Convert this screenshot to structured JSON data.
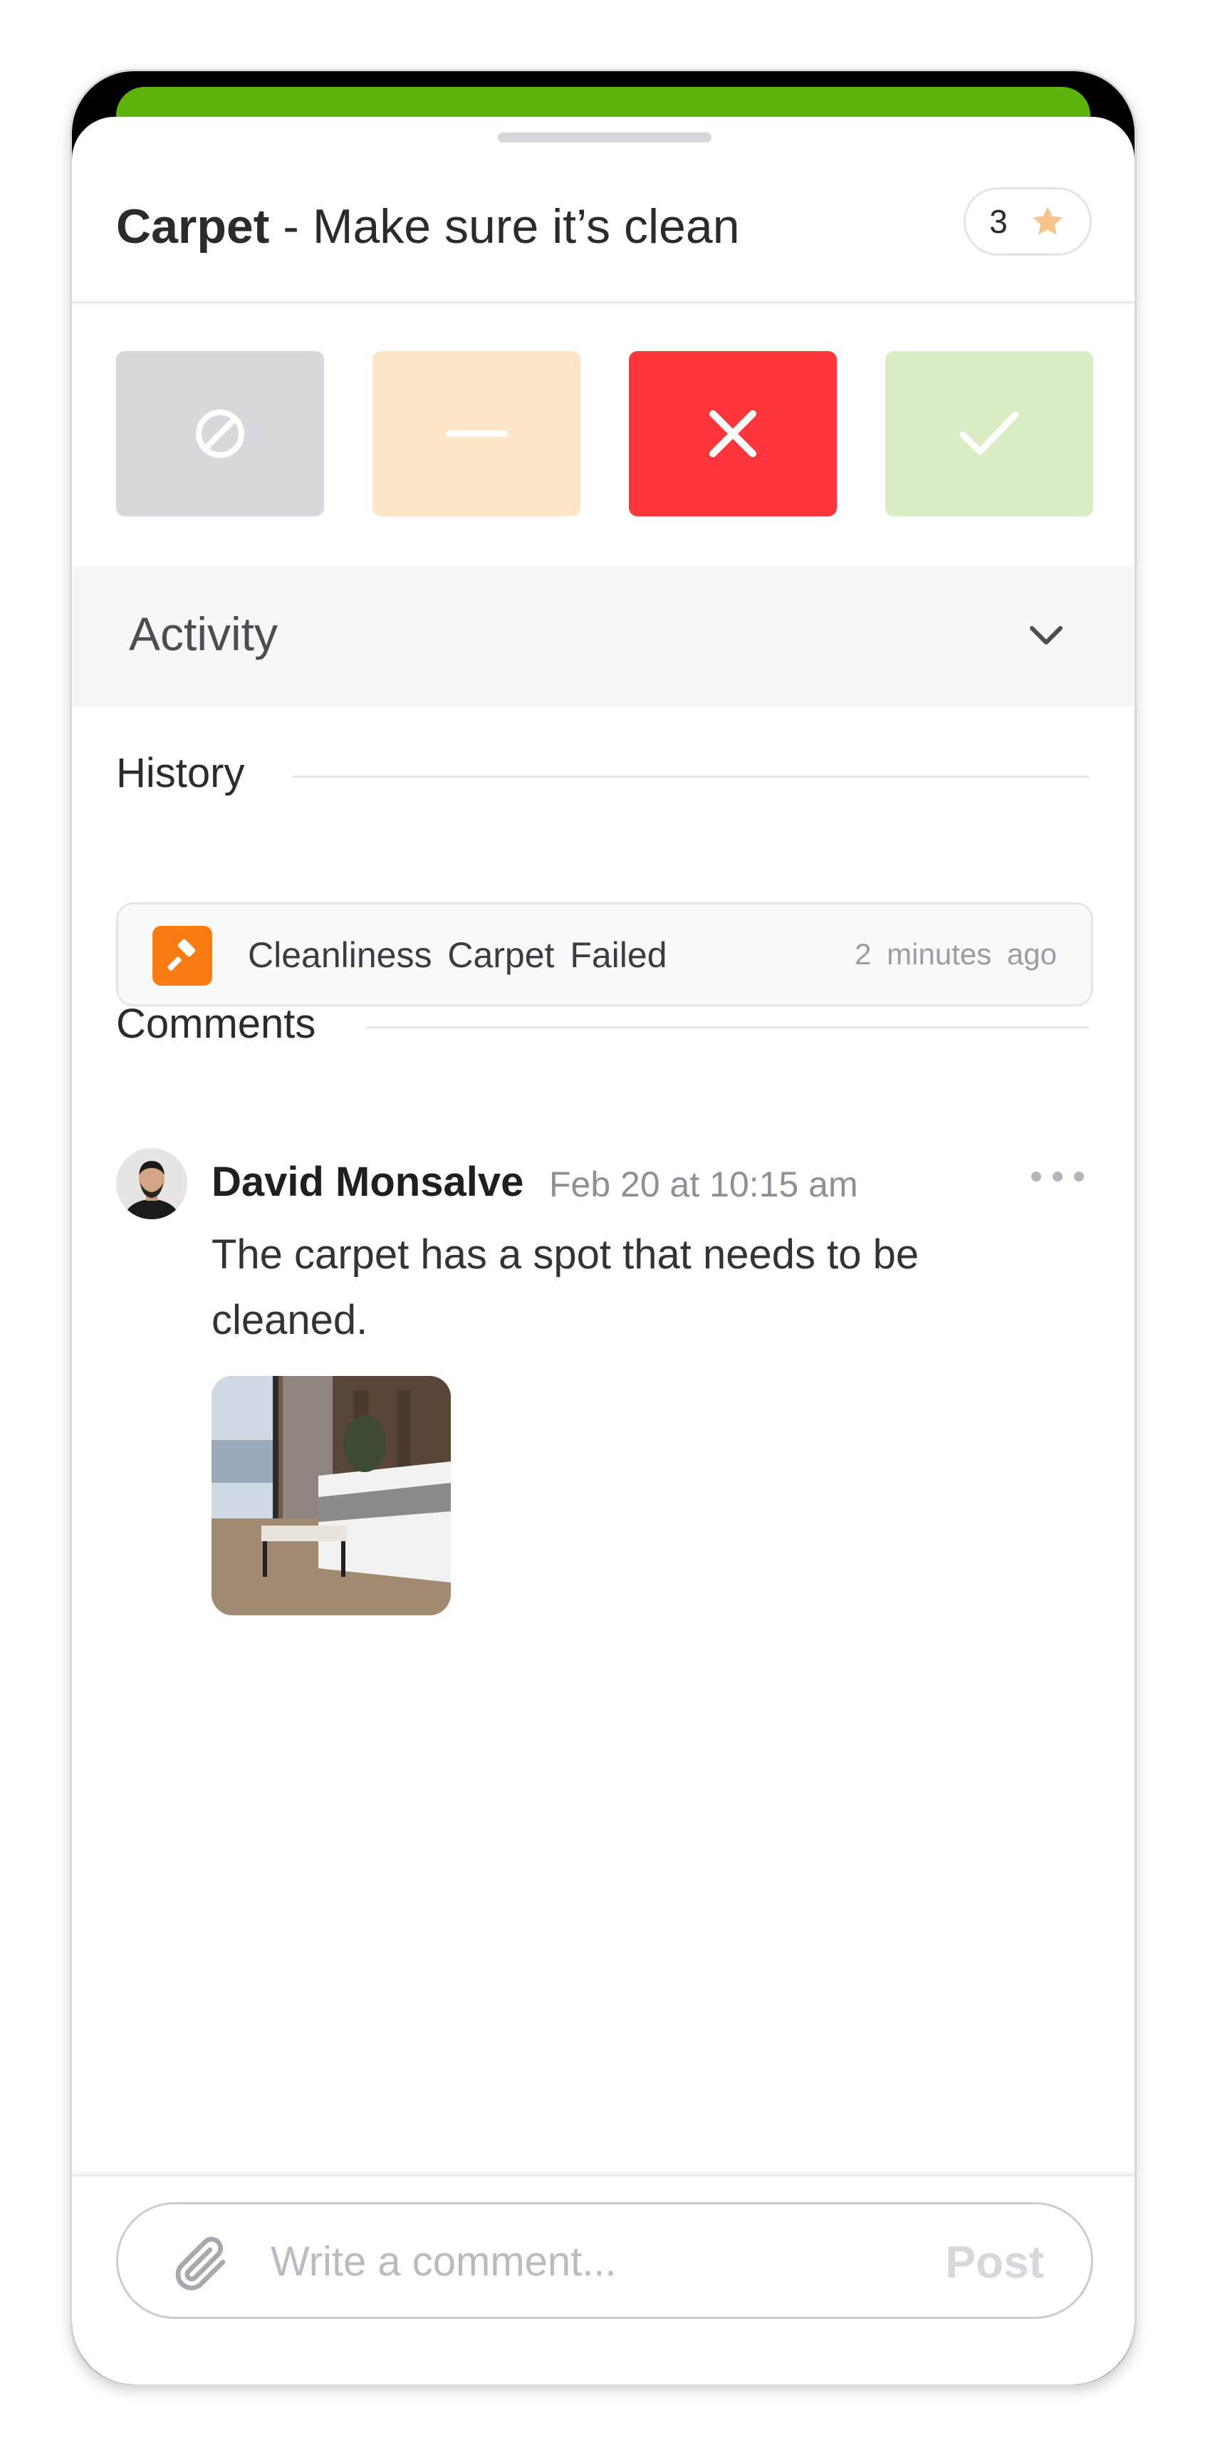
{
  "task": {
    "item_name": "Carpet",
    "item_description": "- Make sure it’s clean",
    "rating_count": "3"
  },
  "status_buttons": [
    {
      "name": "not-applicable",
      "icon": "prohibited-icon",
      "color": "#d6d8dc"
    },
    {
      "name": "partial",
      "icon": "minus-icon",
      "color": "#fde6c6"
    },
    {
      "name": "fail",
      "icon": "x-icon",
      "color": "#fe363b",
      "selected": true
    },
    {
      "name": "pass",
      "icon": "check-icon",
      "color": "#d8edc4"
    }
  ],
  "activity": {
    "label": "Activity",
    "expanded": true,
    "history": {
      "title": "History",
      "items": [
        {
          "icon": "hammer-icon",
          "text": "Cleanliness Carpet Failed",
          "time": "2 minutes ago"
        }
      ]
    },
    "comments": {
      "title": "Comments",
      "items": [
        {
          "author": "David Monsalve",
          "time": "Feb 20 at 10:15 am",
          "text": "The carpet has a spot that needs to be cleaned.",
          "has_image": true
        }
      ]
    }
  },
  "composer": {
    "placeholder": "Write a comment...",
    "post_label": "Post"
  },
  "colors": {
    "accent_green": "#5cb30c",
    "fail_red": "#fe363b",
    "history_orange": "#f97c12",
    "star": "#f6c48a"
  }
}
